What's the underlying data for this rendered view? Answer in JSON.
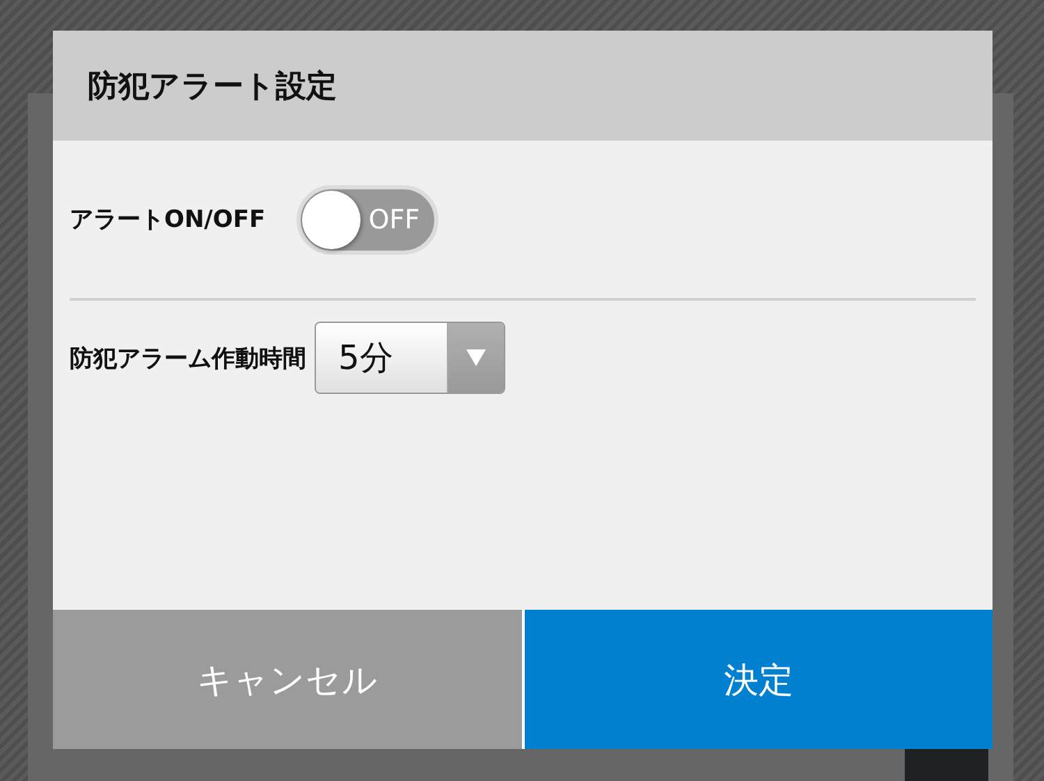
{
  "dialog": {
    "title": "防犯アラート設定",
    "alert_toggle": {
      "label": "アラートON/OFF",
      "on": false,
      "state_text": "OFF"
    },
    "alarm_duration": {
      "label": "防犯アラーム作動時間",
      "value": "5分"
    },
    "buttons": [
      {
        "label": "キャンセル",
        "kind": "cancel"
      },
      {
        "label": "決定",
        "kind": "confirm"
      }
    ]
  }
}
